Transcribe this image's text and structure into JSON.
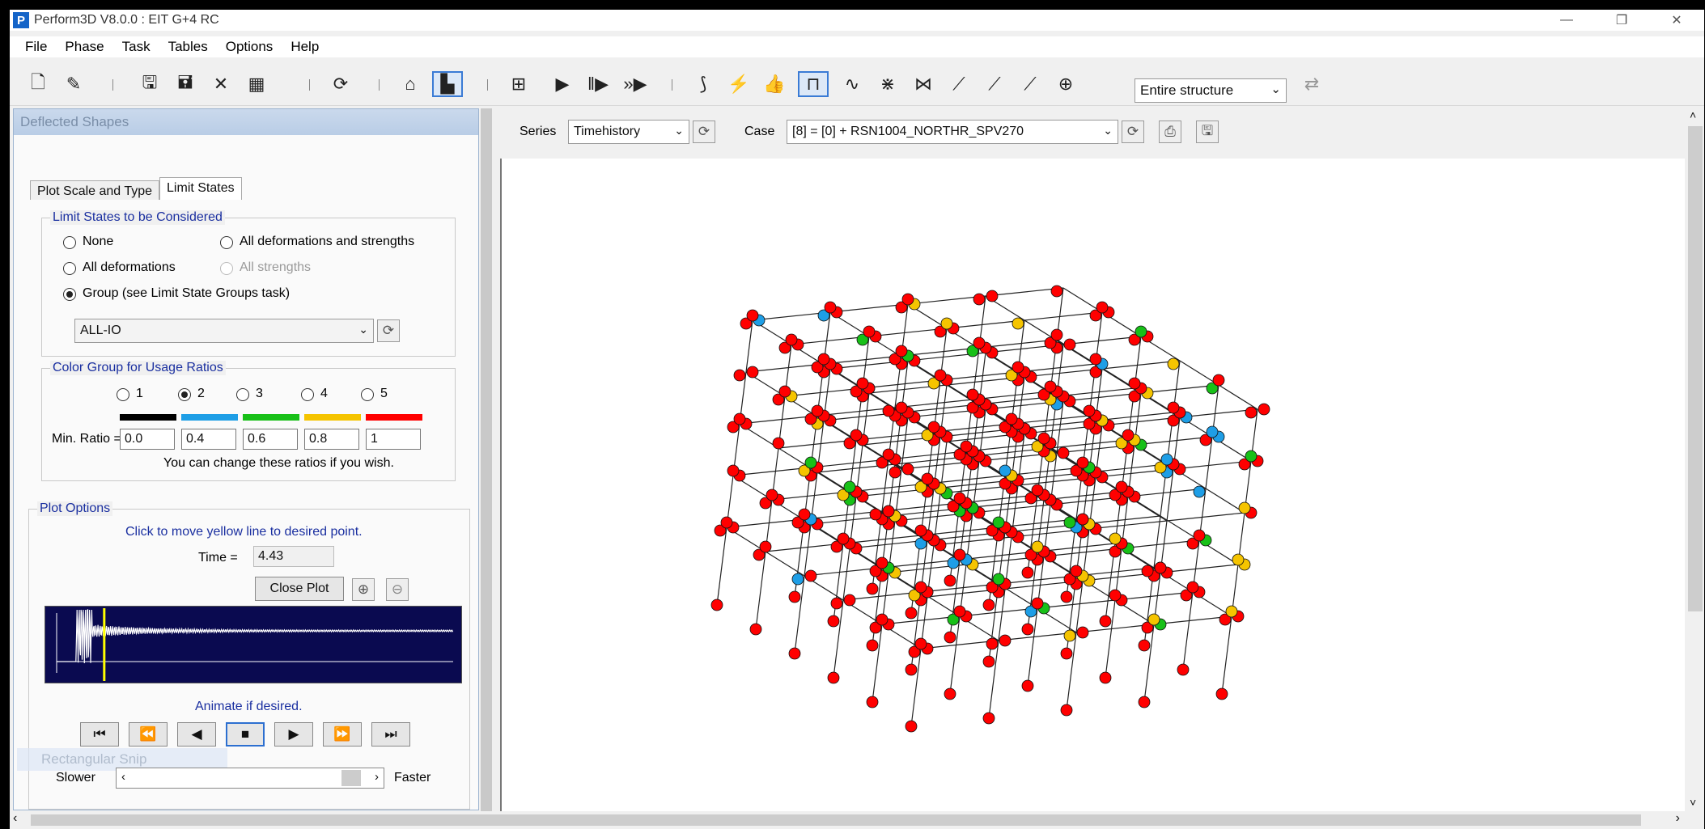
{
  "window": {
    "title": "Perform3D V8.0.0 : EIT G+4 RC",
    "app_icon": "P"
  },
  "menu": [
    "File",
    "Phase",
    "Task",
    "Tables",
    "Options",
    "Help"
  ],
  "toolbar": {
    "structure_select": "Entire structure"
  },
  "panel": {
    "header": "Deflected Shapes",
    "tabs": [
      {
        "label": "Plot Scale and Type",
        "active": false
      },
      {
        "label": "Limit States",
        "active": true
      }
    ],
    "limit_states": {
      "title": "Limit States to be Considered",
      "options": {
        "none": "None",
        "all_def_str": "All deformations and strengths",
        "all_def": "All deformations",
        "all_str": "All strengths",
        "group": "Group (see Limit State Groups task)"
      },
      "selected": "group",
      "group_value": "ALL-IO"
    },
    "color_group": {
      "title": "Color Group for Usage Ratios",
      "options": [
        "1",
        "2",
        "3",
        "4",
        "5"
      ],
      "selected": "2",
      "colors": [
        "#000000",
        "#1e9ee6",
        "#18c018",
        "#f5c400",
        "#ff0000"
      ],
      "min_ratio_label": "Min. Ratio =",
      "ratios": [
        "0.0",
        "0.4",
        "0.6",
        "0.8",
        "1"
      ],
      "hint": "You can change these ratios if you wish."
    },
    "plot_options": {
      "title": "Plot Options",
      "instruction": "Click to move yellow line to desired point.",
      "time_label": "Time =",
      "time_value": "4.43",
      "close_plot": "Close Plot",
      "animate_label": "Animate if desired.",
      "slower": "Slower",
      "faster": "Faster",
      "cursor_time_fraction": 0.12
    },
    "snip_overlay": "Rectangular Snip"
  },
  "viewport": {
    "series_label": "Series",
    "series_value": "Timehistory",
    "case_label": "Case",
    "case_value": "[8] = [0] + RSN1004_NORTHR_SPV270"
  },
  "icons": {
    "toolbar": [
      "new-file-icon",
      "open-icon",
      "save-icon",
      "save-as-icon",
      "delete-icon",
      "table-icon",
      "refresh-icon",
      "structure-icon",
      "deflected-shape-icon",
      "frame-icon",
      "run-icon",
      "pause-run-icon",
      "fast-forward-icon",
      "spring-icon",
      "lightning-icon",
      "thumbs-up-icon",
      "moment-frame-icon",
      "waveform-icon",
      "spring-element-icon",
      "truss-icon",
      "drift-icon",
      "dc-icon",
      "dc-ratio-icon",
      "add-circle-icon",
      "export-icon"
    ]
  }
}
